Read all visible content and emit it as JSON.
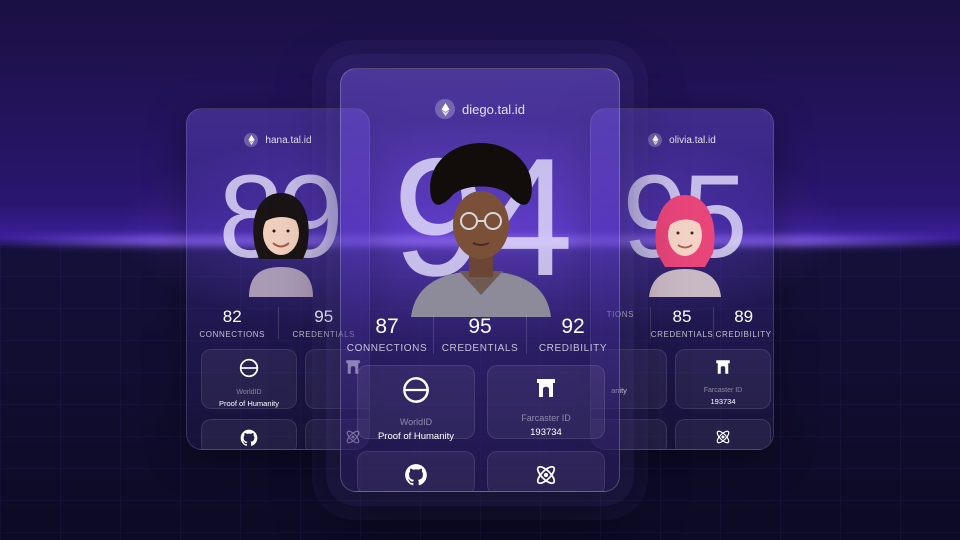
{
  "cards": {
    "left": {
      "handle": "hana.tal.id",
      "score": "89",
      "stats": [
        {
          "value": "82",
          "label": "CONNECTIONS"
        },
        {
          "value": "95",
          "label": "CREDENTIALS"
        }
      ],
      "tiles": [
        {
          "icon": "worldid-icon",
          "sub": "WorldID",
          "value": "Proof of Humanity"
        },
        {
          "icon": "farcaster-icon",
          "sub": "",
          "value": ""
        },
        {
          "icon": "github-icon",
          "sub": "",
          "value": ""
        },
        {
          "icon": "atom-icon",
          "sub": "",
          "value": ""
        }
      ]
    },
    "center": {
      "handle": "diego.tal.id",
      "score": "94",
      "stats": [
        {
          "value": "87",
          "label": "CONNECTIONS"
        },
        {
          "value": "95",
          "label": "CREDENTIALS"
        },
        {
          "value": "92",
          "label": "CREDIBILITY"
        }
      ],
      "tiles": [
        {
          "icon": "worldid-icon",
          "sub": "WorldID",
          "value": "Proof of Humanity"
        },
        {
          "icon": "farcaster-icon",
          "sub": "Farcaster ID",
          "value": "193734"
        },
        {
          "icon": "github-icon",
          "sub": "",
          "value": ""
        },
        {
          "icon": "atom-icon",
          "sub": "",
          "value": ""
        }
      ]
    },
    "right": {
      "handle": "olivia.tal.id",
      "score": "95",
      "stats": [
        {
          "value": "",
          "label": "TIONS"
        },
        {
          "value": "85",
          "label": "CREDENTIALS"
        },
        {
          "value": "89",
          "label": "CREDIBILITY"
        }
      ],
      "tiles": [
        {
          "icon": "worldid-icon",
          "sub": "",
          "value": "anity"
        },
        {
          "icon": "farcaster-icon",
          "sub": "Farcaster ID",
          "value": "193734"
        },
        {
          "icon": "github-icon",
          "sub": "",
          "value": ""
        },
        {
          "icon": "atom-icon",
          "sub": "",
          "value": ""
        }
      ]
    }
  },
  "colors": {
    "background": "#120a2e",
    "accent_glow": "#8c5aff",
    "left_avatar_hair": "#1b1414",
    "center_avatar_hair": "#120d0b",
    "right_avatar_hair": "#e8457a"
  }
}
